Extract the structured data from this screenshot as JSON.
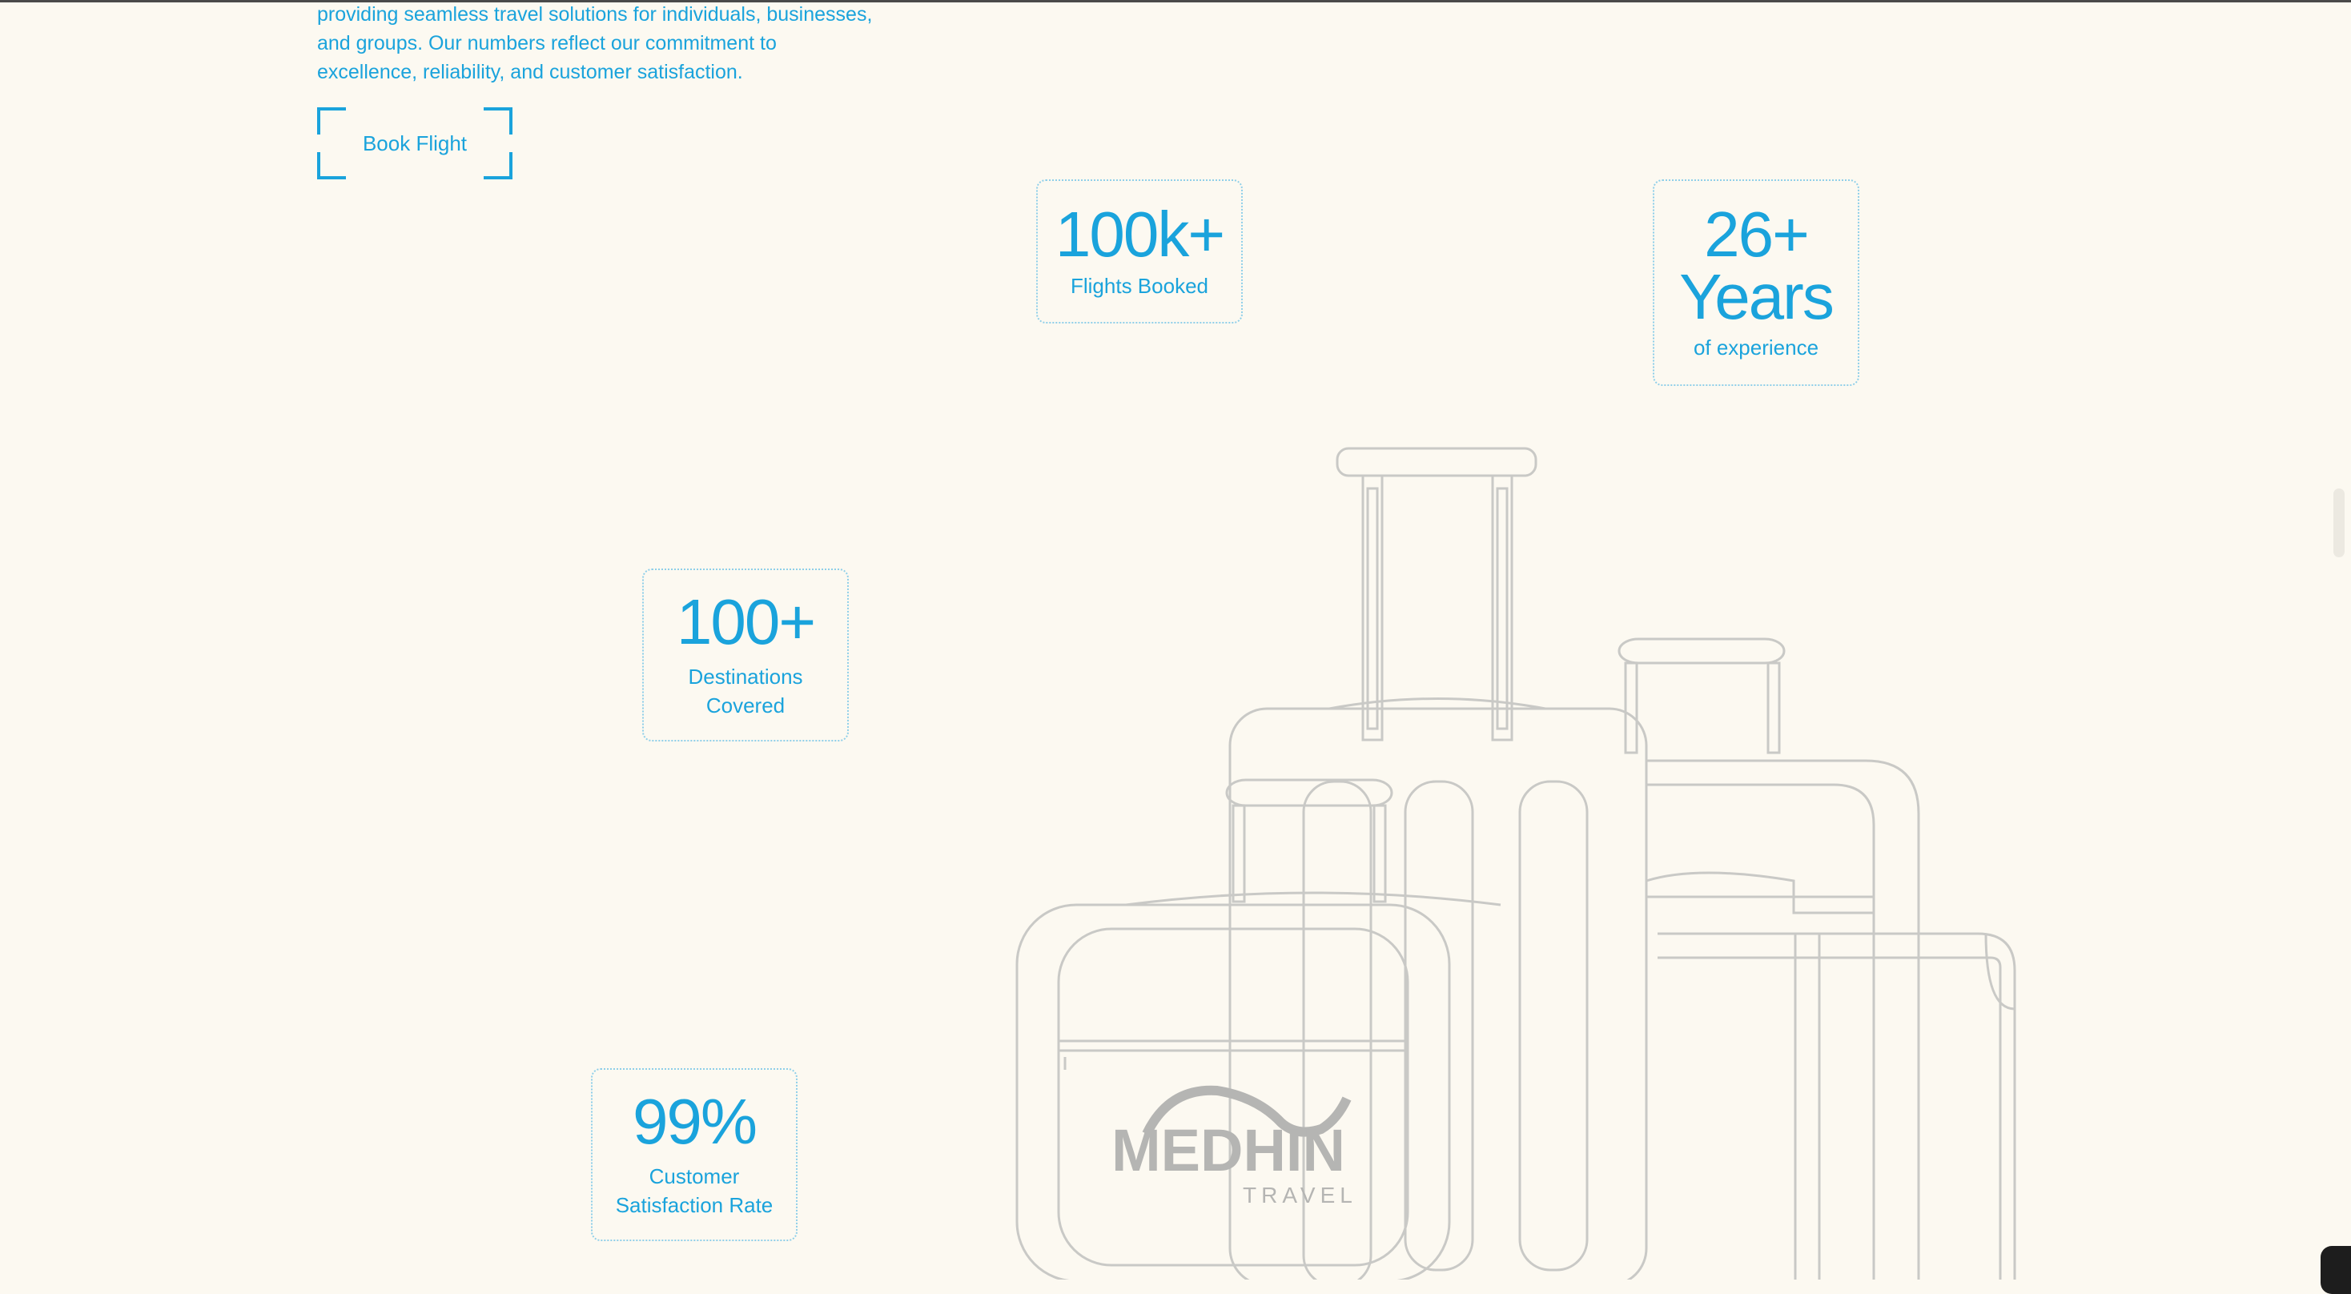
{
  "intro": {
    "text": "providing seamless travel solutions for individuals, businesses, and groups. Our numbers reflect our commitment to excellence, reliability, and customer satisfaction."
  },
  "book_button": {
    "label": "Book Flight"
  },
  "stats": {
    "flights": {
      "value": "100k+",
      "label": "Flights Booked"
    },
    "years": {
      "value_line1": "26+",
      "value_line2": "Years",
      "label": "of experience"
    },
    "destinations": {
      "value": "100+",
      "label_line1": "Destinations",
      "label_line2": "Covered"
    },
    "satisfaction": {
      "value": "99%",
      "label_line1": "Customer",
      "label_line2": "Satisfaction Rate"
    }
  },
  "logo": {
    "name": "MEDHIN",
    "sub": "TRAVEL"
  },
  "colors": {
    "accent": "#1aa3dc",
    "background": "#fcf9f1",
    "outline": "#c9c9c6"
  }
}
